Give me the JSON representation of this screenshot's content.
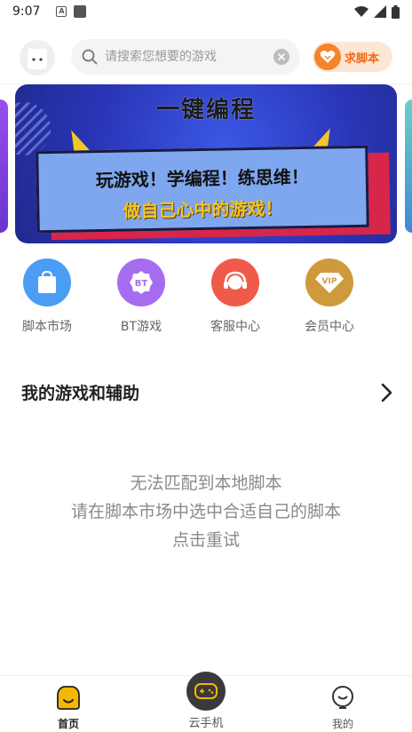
{
  "status_bar": {
    "time": "9:07",
    "a_label": "A"
  },
  "header": {
    "search_placeholder": "请搜索您想要的游戏",
    "request_label": "求脚本"
  },
  "banner": {
    "title": "一键编程",
    "line1": "玩游戏！学编程！练思维！",
    "line2": "做自己心中的游戏！"
  },
  "quick_entries": [
    {
      "label": "脚本市场",
      "icon": "shopping-bag-icon",
      "color": "#4a9cf5"
    },
    {
      "label": "BT游戏",
      "icon": "bt-badge-icon",
      "color": "#a66cf0",
      "badge_text": "BT"
    },
    {
      "label": "客服中心",
      "icon": "headset-icon",
      "color": "#f05a4a"
    },
    {
      "label": "会员中心",
      "icon": "vip-diamond-icon",
      "color": "#cf9a3c",
      "badge_text": "VIP"
    }
  ],
  "my_games": {
    "title": "我的游戏和辅助",
    "empty_lines": [
      "无法匹配到本地脚本",
      "请在脚本市场中选中合适自己的脚本",
      "点击重试"
    ]
  },
  "bottom_nav": {
    "home": "首页",
    "cloud": "云手机",
    "mine": "我的"
  },
  "colors": {
    "accent": "#f7832a",
    "home_active": "#f5b800"
  }
}
